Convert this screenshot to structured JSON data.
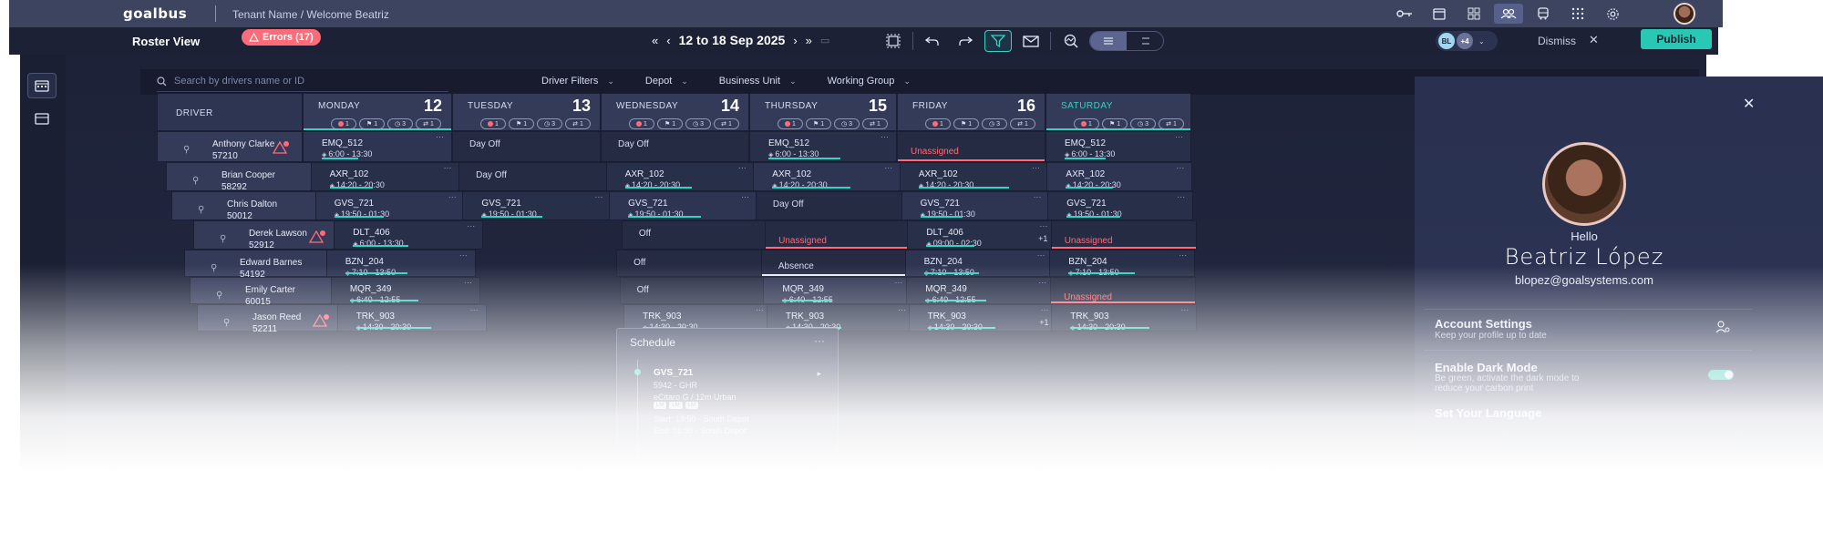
{
  "app": {
    "logo": "goalbus",
    "breadcrumb": "Tenant Name / Welcome Beatriz"
  },
  "toolbar": {
    "title": "Roster View",
    "errors_label": "Errors (17)",
    "date_range": "12 to 18 Sep 2025",
    "users_chip": {
      "initials": "BL",
      "more": "+4"
    },
    "dismiss_label": "Dismiss",
    "publish_label": "Publish"
  },
  "filters": {
    "search_placeholder": "Search by drivers name or ID",
    "items": [
      "Driver Filters",
      "Depot",
      "Business Unit",
      "Working Group"
    ]
  },
  "grid": {
    "driver_header": "DRIVER",
    "days": [
      {
        "name": "MONDAY",
        "num": "12"
      },
      {
        "name": "TUESDAY",
        "num": "13"
      },
      {
        "name": "WEDNESDAY",
        "num": "14"
      },
      {
        "name": "THURSDAY",
        "num": "15"
      },
      {
        "name": "FRIDAY",
        "num": "16"
      },
      {
        "name": "SATURDAY",
        "num": ""
      }
    ],
    "badge_counts": [
      "1",
      "1",
      "3",
      "1"
    ],
    "drivers": [
      {
        "name": "Anthony Clarke",
        "id": "57210",
        "warn": true
      },
      {
        "name": "Brian Cooper",
        "id": "58292",
        "warn": false
      },
      {
        "name": "Chris Dalton",
        "id": "50012",
        "warn": false
      },
      {
        "name": "Derek Lawson",
        "id": "52912",
        "warn": true
      },
      {
        "name": "Edward Barnes",
        "id": "54192",
        "warn": false
      },
      {
        "name": "Emily Carter",
        "id": "60015",
        "warn": false
      },
      {
        "name": "Jason Reed",
        "id": "52211",
        "warn": true
      }
    ],
    "rows": [
      [
        {
          "type": "shift",
          "code": "EMQ_512",
          "time": "6:00 - 13:30"
        },
        {
          "type": "dayoff",
          "label": "Day Off"
        },
        {
          "type": "dayoff",
          "label": "Day Off"
        },
        {
          "type": "shift",
          "code": "EMQ_512",
          "time": "6:00 - 13:30"
        },
        {
          "type": "unassigned",
          "label": "Unassigned"
        },
        {
          "type": "shift",
          "code": "EMQ_512",
          "time": "6:00 - 13:30"
        }
      ],
      [
        {
          "type": "shift",
          "code": "AXR_102",
          "time": "14:20 - 20:30"
        },
        {
          "type": "dayoff",
          "label": "Day Off"
        },
        {
          "type": "shift",
          "code": "AXR_102",
          "time": "14:20 - 20:30"
        },
        {
          "type": "shift",
          "code": "AXR_102",
          "time": "14:20 - 20:30"
        },
        {
          "type": "shift",
          "code": "AXR_102",
          "time": "14:20 - 20:30"
        },
        {
          "type": "shift",
          "code": "AXR_102",
          "time": "14:20 - 20:30"
        }
      ],
      [
        {
          "type": "shift",
          "code": "GVS_721",
          "time": "19:50 - 01:30"
        },
        {
          "type": "shift",
          "code": "GVS_721",
          "time": "19:50 - 01:30"
        },
        {
          "type": "shift",
          "code": "GVS_721",
          "time": "19:50 - 01:30"
        },
        {
          "type": "dayoff",
          "label": "Day Off"
        },
        {
          "type": "shift",
          "code": "GVS_721",
          "time": "19:50 - 01:30"
        },
        {
          "type": "shift",
          "code": "GVS_721",
          "time": "19:50 - 01:30"
        }
      ],
      [
        {
          "type": "shift",
          "code": "DLT_406",
          "time": "6:00 - 13:30"
        },
        {
          "type": "hidden"
        },
        {
          "type": "dayoff",
          "label": "Off"
        },
        {
          "type": "unassigned",
          "label": "Unassigned"
        },
        {
          "type": "shift",
          "code": "DLT_406",
          "time": "09:00 - 02:30",
          "plus": "+1"
        },
        {
          "type": "unassigned",
          "label": "Unassigned"
        }
      ],
      [
        {
          "type": "shift",
          "code": "BZN_204",
          "time": "7:10 - 13:50"
        },
        {
          "type": "hidden"
        },
        {
          "type": "dayoff",
          "label": "Off"
        },
        {
          "type": "absence",
          "label": "Absence"
        },
        {
          "type": "shift",
          "code": "BZN_204",
          "time": "7:10 - 13:50"
        },
        {
          "type": "shift",
          "code": "BZN_204",
          "time": "7:10 - 13:50"
        }
      ],
      [
        {
          "type": "shift",
          "code": "MQR_349",
          "time": "6:40 - 12:55"
        },
        {
          "type": "hidden"
        },
        {
          "type": "dayoff",
          "label": "Off"
        },
        {
          "type": "shift",
          "code": "MQR_349",
          "time": "6:40 - 12:55"
        },
        {
          "type": "shift",
          "code": "MQR_349",
          "time": "6:40 - 12:55"
        },
        {
          "type": "unassigned",
          "label": "Unassigned"
        }
      ],
      [
        {
          "type": "shift",
          "code": "TRK_903",
          "time": "14:30 - 20:30"
        },
        {
          "type": "hidden"
        },
        {
          "type": "shift",
          "code": "TRK_903",
          "time": "14:30 - 20:30"
        },
        {
          "type": "shift",
          "code": "TRK_903",
          "time": "14:30 - 20:30"
        },
        {
          "type": "shift",
          "code": "TRK_903",
          "time": "14:30 - 20:30",
          "plus": "+1"
        },
        {
          "type": "shift",
          "code": "TRK_903",
          "time": "14:30 - 20:30"
        }
      ]
    ]
  },
  "schedule_popup": {
    "title": "Schedule",
    "code": "GVS_721",
    "line1": "5942 - GHR",
    "line2": "eCitaro G / 12m Urban",
    "tags": [
      "LM",
      "LM",
      "LM"
    ],
    "start": "Start: 19:50 - South Depot",
    "end": "End: 01:30 - South Depot"
  },
  "profile": {
    "hello": "Hello",
    "name": "Beatriz López",
    "email": "blopez@goalsystems.com",
    "account_title": "Account Settings",
    "account_sub": "Keep your profile up to date",
    "dark_title": "Enable Dark Mode",
    "dark_sub1": "Be green, activate the dark mode to",
    "dark_sub2": "reduce your carbon print",
    "dark_mode_on": true,
    "language_title": "Set Your Language"
  },
  "colors": {
    "accent": "#35d3c2",
    "error": "#ff6b78",
    "publish": "#27c9b4",
    "background": "#1d2238"
  }
}
